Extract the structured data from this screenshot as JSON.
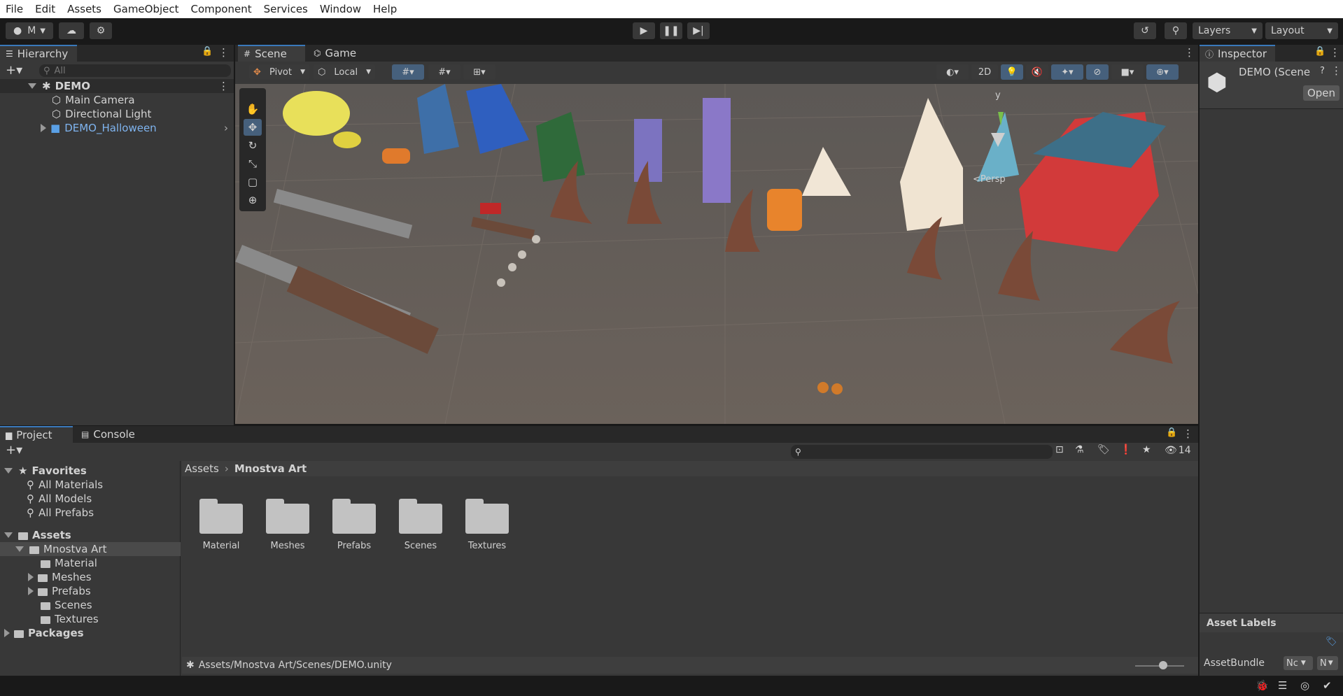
{
  "menubar": {
    "items": [
      "File",
      "Edit",
      "Assets",
      "GameObject",
      "Component",
      "Services",
      "Window",
      "Help"
    ]
  },
  "toolbar": {
    "account": "M",
    "layers": "Layers",
    "layout": "Layout"
  },
  "hierarchy": {
    "tab": "Hierarchy",
    "search_placeholder": "All",
    "scene": "DEMO",
    "items": [
      "Main Camera",
      "Directional Light",
      "DEMO_Halloween"
    ]
  },
  "scene_view": {
    "tabs": [
      "Scene",
      "Game"
    ],
    "pivot": "Pivot",
    "local": "Local",
    "mode_2d": "2D",
    "persp": "<Persp",
    "gizmo_y": "y"
  },
  "inspector": {
    "tab": "Inspector",
    "title": "DEMO (Scene",
    "open": "Open",
    "asset_labels": "Asset Labels",
    "assetbundle": "AssetBundle",
    "ab_value": "Nc",
    "ab_variant": "N"
  },
  "project": {
    "tabs": [
      "Project",
      "Console"
    ],
    "hidden_count": "14",
    "favorites": {
      "label": "Favorites",
      "items": [
        "All Materials",
        "All Models",
        "All Prefabs"
      ]
    },
    "tree": {
      "assets": "Assets",
      "mnostva": "Mnostva Art",
      "children": [
        "Material",
        "Meshes",
        "Prefabs",
        "Scenes",
        "Textures"
      ],
      "packages": "Packages"
    },
    "breadcrumb": [
      "Assets",
      "Mnostva Art"
    ],
    "folders": [
      "Material",
      "Meshes",
      "Prefabs",
      "Scenes",
      "Textures"
    ],
    "path": "Assets/Mnostva Art/Scenes/DEMO.unity"
  }
}
